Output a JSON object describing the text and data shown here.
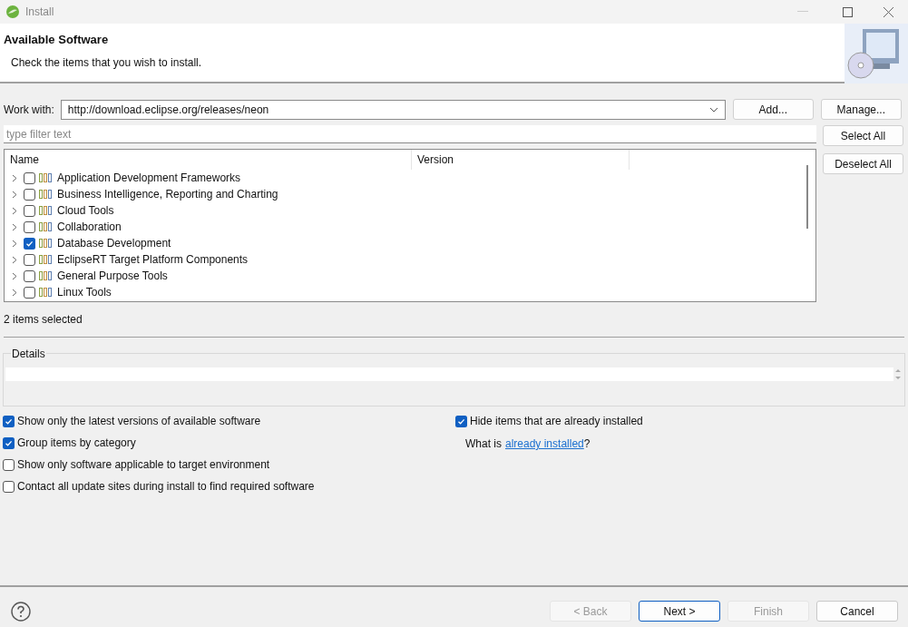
{
  "window": {
    "title": "Install"
  },
  "header": {
    "title": "Available Software",
    "subtitle": "Check the items that you wish to install."
  },
  "work_with": {
    "label": "Work with:",
    "value": "http://download.eclipse.org/releases/neon"
  },
  "site_buttons": [
    "Add...",
    "Manage..."
  ],
  "filter": {
    "placeholder": "type filter text"
  },
  "selection_buttons": [
    "Select All",
    "Deselect All"
  ],
  "tree": {
    "columns": [
      "Name",
      "Version"
    ],
    "rows": [
      {
        "label": "Application Development Frameworks",
        "checked": false
      },
      {
        "label": "Business Intelligence, Reporting and Charting",
        "checked": false
      },
      {
        "label": "Cloud Tools",
        "checked": false
      },
      {
        "label": "Collaboration",
        "checked": false
      },
      {
        "label": "Database Development",
        "checked": true
      },
      {
        "label": "EclipseRT Target Platform Components",
        "checked": false
      },
      {
        "label": "General Purpose Tools",
        "checked": false
      },
      {
        "label": "Linux Tools",
        "checked": false
      }
    ]
  },
  "selection_count": "2 items selected",
  "details": {
    "label": "Details"
  },
  "options_left": [
    {
      "label": "Show only the latest versions of available software",
      "checked": true
    },
    {
      "label": "Group items by category",
      "checked": true
    },
    {
      "label": "Show only software applicable to target environment",
      "checked": false
    },
    {
      "label": "Contact all update sites during install to find required software",
      "checked": false
    }
  ],
  "options_right": {
    "checkbox": {
      "label": "Hide items that are already installed",
      "checked": true
    },
    "prefix": "What is",
    "link": "already installed",
    "suffix": "?"
  },
  "footer_buttons": [
    {
      "label": "< Back",
      "disabled": true,
      "default": false
    },
    {
      "label": "Next >",
      "disabled": false,
      "default": true
    },
    {
      "label": "Finish",
      "disabled": true,
      "default": false
    },
    {
      "label": "Cancel",
      "disabled": false,
      "default": false
    }
  ]
}
